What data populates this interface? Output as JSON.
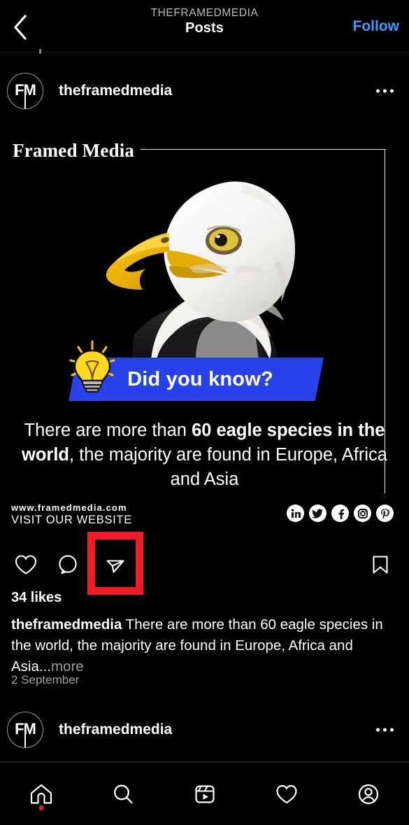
{
  "header": {
    "back_icon": "chevron-left-icon",
    "eyebrow": "THEFRAMEDMEDIA",
    "title": "Posts",
    "follow_label": "Follow",
    "follow_color": "#3d9bf5"
  },
  "post": {
    "avatar_initials": "FM",
    "username": "theframedmedia",
    "menu_icon": "more-options-icon",
    "media": {
      "brand": "Framed Media",
      "banner_text": "Did you know?",
      "banner_color": "#2742e8",
      "bulb_icon": "lightbulb-icon",
      "fact_part1": "There are more than ",
      "fact_bold1": "60 eagle species in the world",
      "fact_part2": ", the majority are found in Europe, Africa and Asia",
      "site_url": "www.framedmedia.com",
      "site_cta": "VISIT OUR WEBSITE",
      "social_icons": [
        "linkedin-icon",
        "twitter-icon",
        "facebook-icon",
        "instagram-icon",
        "pinterest-icon"
      ]
    },
    "actions": {
      "like_icon": "heart-icon",
      "comment_icon": "comment-icon",
      "share_icon": "share-paper-plane-icon",
      "save_icon": "bookmark-icon",
      "highlight_color": "#ef1c26",
      "highlighted_action": "share-paper-plane-icon"
    },
    "likes": "34 likes",
    "caption_user": "theframedmedia",
    "caption_text": " There are more than 60 eagle species in the world, the majority are found in Europe, Africa and Asia...",
    "caption_more": "more",
    "date": "2 September"
  },
  "next_post": {
    "avatar_initials": "FM",
    "username": "theframedmedia",
    "menu_icon": "more-options-icon"
  },
  "bottom_nav": {
    "items": [
      {
        "icon": "home-icon",
        "active": true,
        "badge": true
      },
      {
        "icon": "search-icon",
        "active": false,
        "badge": false
      },
      {
        "icon": "reels-icon",
        "active": false,
        "badge": false
      },
      {
        "icon": "activity-heart-icon",
        "active": false,
        "badge": false
      },
      {
        "icon": "profile-icon",
        "active": false,
        "badge": false
      }
    ]
  }
}
